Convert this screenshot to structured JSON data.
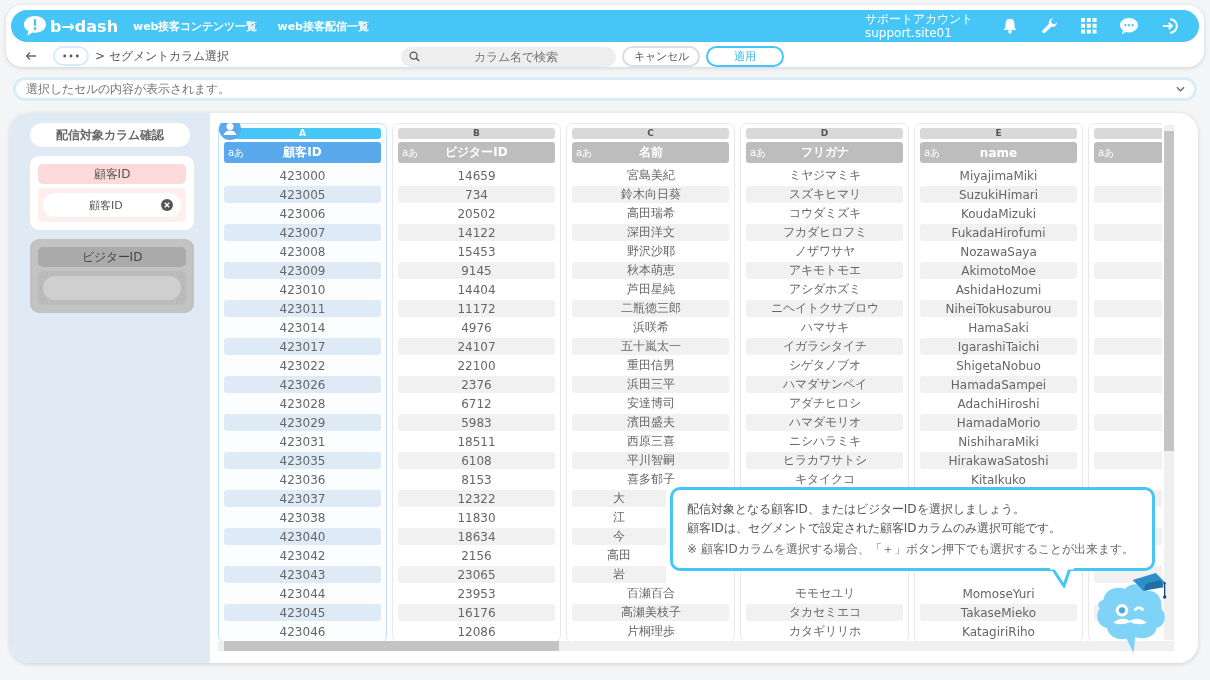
{
  "header": {
    "logo": "b→dash",
    "nav": [
      "web接客コンテンツ一覧",
      "web接客配信一覧"
    ],
    "account": {
      "label": "サポートアカウント",
      "id": "support.site01"
    }
  },
  "toolbar": {
    "breadcrumb": "> セグメントカラム選択",
    "search": {
      "placeholder": "カラム名で検索"
    },
    "buttons": [
      {
        "label": "キャンセル",
        "kind": "secondary"
      },
      {
        "label": "適用",
        "kind": "primary"
      }
    ]
  },
  "cell_viewer": {
    "placeholder": "選択したセルの内容が表示されます。"
  },
  "sidebar": {
    "title": "配信対象カラム確認",
    "groups": [
      {
        "label": "顧客ID",
        "selected": true,
        "chips": [
          "顧客ID"
        ]
      },
      {
        "label": "ビジターID",
        "selected": false
      }
    ]
  },
  "table": {
    "columns": [
      {
        "letter": "A",
        "type_label": "aあ",
        "name": "顧客ID",
        "selected": true
      },
      {
        "letter": "B",
        "type_label": "aあ",
        "name": "ビジターID",
        "selected": false
      },
      {
        "letter": "C",
        "type_label": "aあ",
        "name": "名前",
        "selected": false
      },
      {
        "letter": "D",
        "type_label": "aあ",
        "name": "フリガナ",
        "selected": false
      },
      {
        "letter": "E",
        "type_label": "aあ",
        "name": "name",
        "selected": false
      },
      {
        "type_label": "aあ",
        "selected": false
      }
    ],
    "rows": [
      [
        "423000",
        "14659",
        "宮島美紀",
        "ミヤジマミキ",
        "MiyajimaMiki"
      ],
      [
        "423005",
        "734",
        "鈴木向日葵",
        "スズキヒマリ",
        "SuzukiHimari"
      ],
      [
        "423006",
        "20502",
        "高田瑞希",
        "コウダミズキ",
        "KoudaMizuki"
      ],
      [
        "423007",
        "14122",
        "深田洋文",
        "フカダヒロフミ",
        "FukadaHirofumi"
      ],
      [
        "423008",
        "15453",
        "野沢沙耶",
        "ノザワサヤ",
        "NozawaSaya"
      ],
      [
        "423009",
        "9145",
        "秋本萌恵",
        "アキモトモエ",
        "AkimotoMoe"
      ],
      [
        "423010",
        "14404",
        "芦田星純",
        "アシダホズミ",
        "AshidaHozumi"
      ],
      [
        "423011",
        "11172",
        "二瓶徳三郎",
        "ニヘイトクサブロウ",
        "NiheiTokusaburou"
      ],
      [
        "423014",
        "4976",
        "浜咲希",
        "ハマサキ",
        "HamaSaki"
      ],
      [
        "423017",
        "24107",
        "五十嵐太一",
        "イガラシタイチ",
        "IgarashiTaichi"
      ],
      [
        "423022",
        "22100",
        "重田信男",
        "シゲタノブオ",
        "ShigetaNobuo"
      ],
      [
        "423026",
        "2376",
        "浜田三平",
        "ハマダサンペイ",
        "HamadaSampei"
      ],
      [
        "423028",
        "6712",
        "安達博司",
        "アダチヒロシ",
        "AdachiHiroshi"
      ],
      [
        "423029",
        "5983",
        "濱田盛夫",
        "ハマダモリオ",
        "HamadaMorio"
      ],
      [
        "423031",
        "18511",
        "西原三喜",
        "ニシハラミキ",
        "NishiharaMiki"
      ],
      [
        "423035",
        "6108",
        "平川智嗣",
        "ヒラカワサトシ",
        "HirakawaSatoshi"
      ],
      [
        "423036",
        "8153",
        "喜多郁子",
        "キタイクコ",
        "KitaIkuko"
      ],
      [
        "423037",
        "12322",
        "大",
        null,
        null
      ],
      [
        "423038",
        "11830",
        "江",
        null,
        null
      ],
      [
        "423040",
        "18634",
        "今",
        null,
        null
      ],
      [
        "423042",
        "2156",
        "高田",
        null,
        null
      ],
      [
        "423043",
        "23065",
        "岩",
        null,
        null
      ],
      [
        "423044",
        "23953",
        "百瀬百合",
        "モモセユリ",
        "MomoseYuri"
      ],
      [
        "423045",
        "16176",
        "高瀬美枝子",
        "タカセミエコ",
        "TakaseMieko"
      ],
      [
        "423046",
        "12086",
        "片桐理歩",
        "カタギリリホ",
        "KatagiriRiho"
      ]
    ]
  },
  "tooltip": {
    "lines": [
      "配信対象となる顧客ID、またはビジターIDを選択しましょう。",
      "顧客IDは、セグメントで設定された顧客IDカラムのみ選択可能です。"
    ],
    "note": "※ 顧客IDカラムを選択する場合、「＋」ボタン押下でも選択することが出来ます。"
  }
}
